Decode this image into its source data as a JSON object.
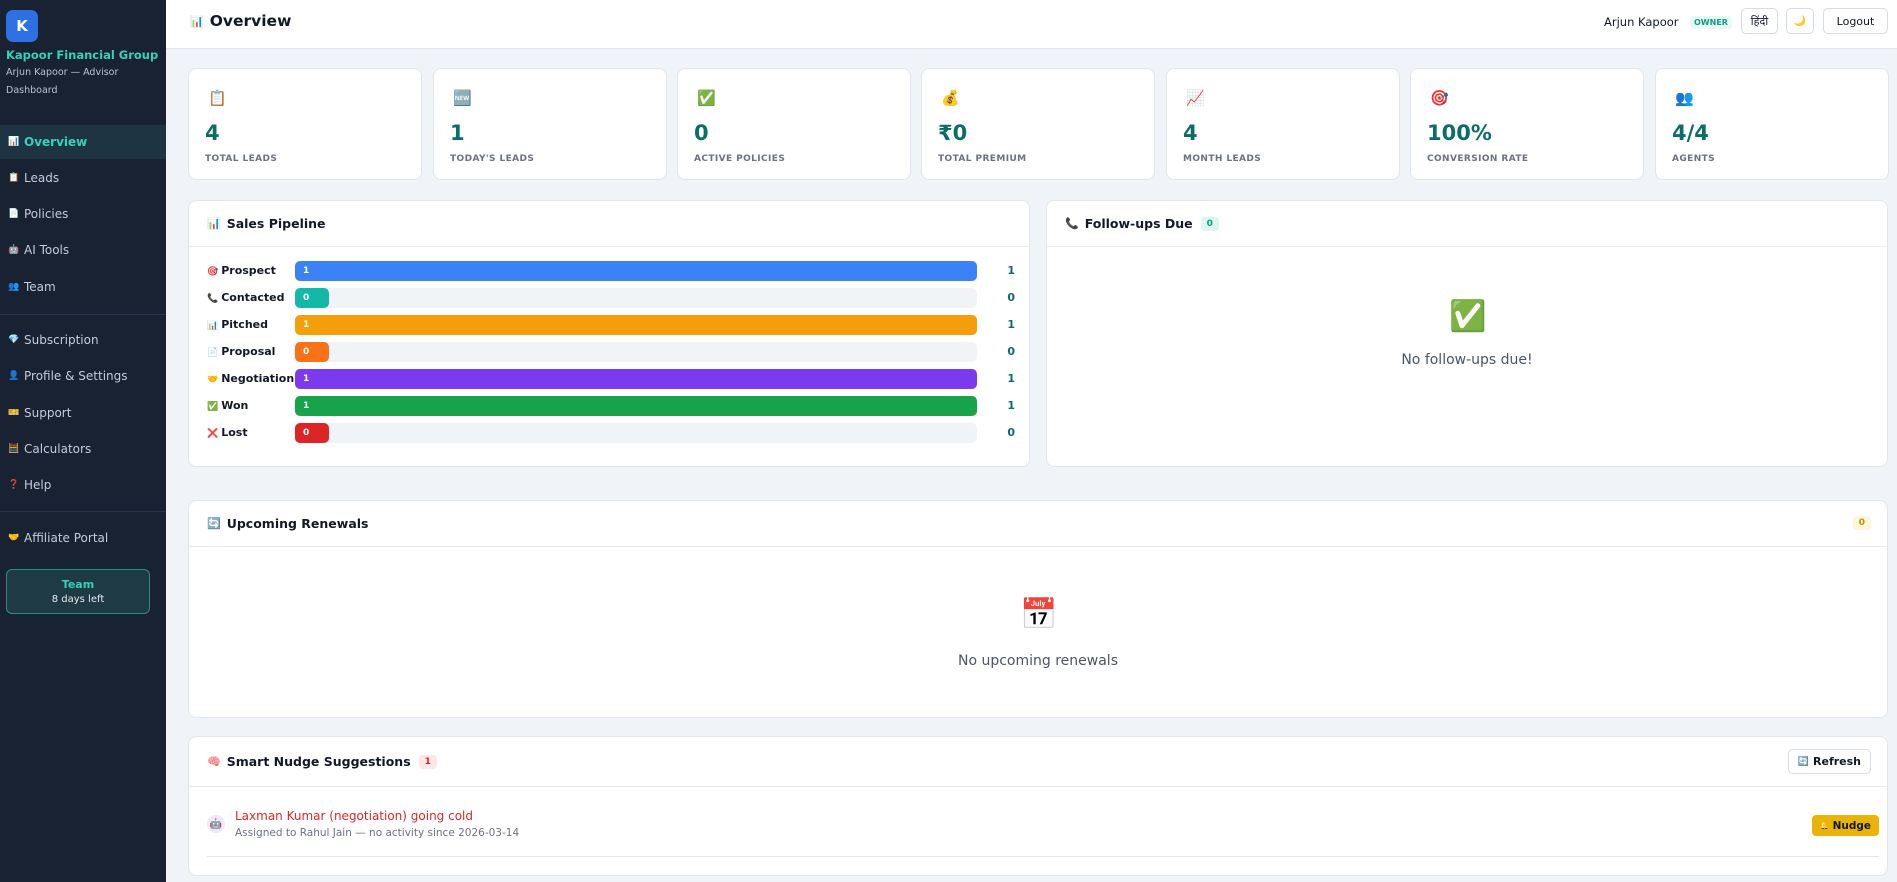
{
  "sidebar": {
    "logo_letter": "K",
    "org_name": "Kapoor Financial Group",
    "user_role": "Arjun Kapoor — Advisor",
    "section": "Dashboard",
    "items": [
      {
        "label": "Overview",
        "icon": "📊"
      },
      {
        "label": "Leads",
        "icon": "📋"
      },
      {
        "label": "Policies",
        "icon": "📄"
      },
      {
        "label": "AI Tools",
        "icon": "🤖"
      },
      {
        "label": "Team",
        "icon": "👥"
      },
      {
        "label": "Subscription",
        "icon": "💎"
      },
      {
        "label": "Profile & Settings",
        "icon": "👤"
      },
      {
        "label": "Support",
        "icon": "🎫"
      },
      {
        "label": "Calculators",
        "icon": "🧮"
      },
      {
        "label": "Help",
        "icon": "❓"
      },
      {
        "label": "Affiliate Portal",
        "icon": "🤝"
      }
    ],
    "trial": {
      "plan": "Team",
      "days_left": "8 days left"
    }
  },
  "header": {
    "title": "Overview",
    "title_icon": "📊",
    "user_name": "Arjun Kapoor",
    "role_badge": "OWNER",
    "lang_button": "हिंदी",
    "theme_icon": "🌙",
    "logout_label": "Logout"
  },
  "stats": [
    {
      "icon": "📋",
      "value": "4",
      "label": "TOTAL LEADS"
    },
    {
      "icon": "🆕",
      "value": "1",
      "label": "TODAY'S LEADS"
    },
    {
      "icon": "✅",
      "value": "0",
      "label": "ACTIVE POLICIES"
    },
    {
      "icon": "💰",
      "value": "₹0",
      "label": "TOTAL PREMIUM"
    },
    {
      "icon": "📈",
      "value": "4",
      "label": "MONTH LEADS"
    },
    {
      "icon": "🎯",
      "value": "100%",
      "label": "CONVERSION RATE"
    },
    {
      "icon": "👥",
      "value": "4/4",
      "label": "AGENTS"
    }
  ],
  "pipeline": {
    "title": "Sales Pipeline",
    "icon": "📊",
    "max": 1,
    "stages": [
      {
        "label": "Prospect",
        "icon": "🎯",
        "value": 1,
        "color": "#3b82f6"
      },
      {
        "label": "Contacted",
        "icon": "📞",
        "value": 0,
        "color": "#14b8a6"
      },
      {
        "label": "Pitched",
        "icon": "📊",
        "value": 1,
        "color": "#f59e0b"
      },
      {
        "label": "Proposal",
        "icon": "📄",
        "value": 0,
        "color": "#f97316"
      },
      {
        "label": "Negotiation",
        "icon": "🤝",
        "value": 1,
        "color": "#7c3aed"
      },
      {
        "label": "Won",
        "icon": "✅",
        "value": 1,
        "color": "#16a34a"
      },
      {
        "label": "Lost",
        "icon": "❌",
        "value": 0,
        "color": "#dc2626"
      }
    ]
  },
  "followups": {
    "title": "Follow-ups Due",
    "icon": "📞",
    "count": "0",
    "empty_icon": "✅",
    "empty_text": "No follow-ups due!"
  },
  "renewals": {
    "title": "Upcoming Renewals",
    "icon": "🔄",
    "count": "0",
    "empty_icon": "📅",
    "empty_text": "No upcoming renewals"
  },
  "nudges": {
    "title": "Smart Nudge Suggestions",
    "icon": "🧠",
    "count": "1",
    "refresh_label": "Refresh",
    "refresh_icon": "🔄",
    "items": [
      {
        "avatar": "🤖",
        "title": "Laxman Kumar (negotiation) going cold",
        "subtitle": "Assigned to Rahul Jain — no activity since 2026-03-14",
        "action_label": "Nudge",
        "action_icon": "🔔"
      }
    ]
  }
}
